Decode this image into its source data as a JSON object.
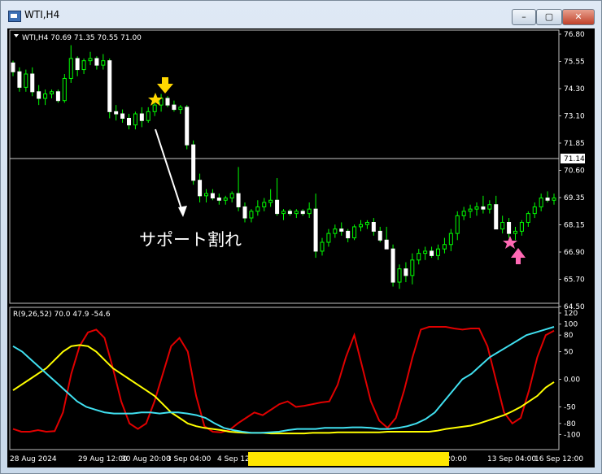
{
  "window": {
    "title": "WTI,H4",
    "min_label": "–",
    "max_label": "▢",
    "close_label": "✕"
  },
  "price_panel": {
    "header": "WTI,H4  70.69 71.35 70.55 71.00",
    "price_labels": [
      "76.80",
      "75.55",
      "74.30",
      "73.10",
      "71.85",
      "70.60",
      "69.35",
      "68.15",
      "66.90",
      "65.70",
      "64.50"
    ],
    "current_price": "71.14",
    "annotation": "サポート割れ"
  },
  "indicator_panel": {
    "header": "R(9,26,52) 70.0 47.9 -54.6",
    "level_labels": [
      "120",
      "100",
      "80",
      "50",
      "0.00",
      "-50",
      "-80",
      "-100"
    ]
  },
  "time_axis": [
    "28 Aug 2024",
    "29 Aug 12:00",
    "30 Aug 20:00",
    "3 Sep 04:00",
    "4 Sep 12",
    "20:00",
    "13 Sep 04:00",
    "16 Sep 12:00"
  ],
  "colors": {
    "background": "#000000",
    "bull_candle": "#00ff00",
    "bear_candle": "#ffffff",
    "line_red": "#e00000",
    "line_yellow": "#ffff00",
    "line_cyan": "#40e0f0",
    "marker_yellow": "#ffd700",
    "marker_pink": "#ff69b4",
    "scroll_thumb": "#ffe600"
  },
  "chart_data": [
    {
      "type": "candlestick",
      "symbol": "WTI",
      "timeframe": "H4",
      "ylim": [
        64.5,
        76.8
      ],
      "ohlc": [
        [
          75.5,
          75.6,
          74.9,
          75.1
        ],
        [
          75.1,
          75.3,
          74.2,
          74.4
        ],
        [
          74.4,
          75.2,
          74.2,
          75.0
        ],
        [
          75.0,
          75.3,
          74.0,
          74.2
        ],
        [
          74.2,
          74.5,
          73.6,
          73.9
        ],
        [
          73.9,
          74.3,
          73.6,
          74.1
        ],
        [
          74.1,
          74.3,
          73.9,
          74.2
        ],
        [
          74.2,
          74.3,
          73.7,
          73.8
        ],
        [
          73.8,
          75.0,
          73.7,
          74.8
        ],
        [
          74.8,
          76.3,
          74.6,
          75.7
        ],
        [
          75.7,
          75.8,
          74.9,
          75.2
        ],
        [
          75.2,
          75.7,
          75.0,
          75.6
        ],
        [
          75.6,
          76.0,
          75.4,
          75.7
        ],
        [
          75.7,
          75.8,
          75.2,
          75.4
        ],
        [
          75.4,
          75.9,
          75.2,
          75.6
        ],
        [
          75.6,
          75.7,
          73.0,
          73.3
        ],
        [
          73.3,
          73.6,
          72.9,
          73.2
        ],
        [
          73.2,
          73.4,
          72.8,
          73.0
        ],
        [
          73.0,
          73.2,
          72.5,
          72.7
        ],
        [
          72.7,
          73.3,
          72.5,
          73.2
        ],
        [
          73.2,
          73.5,
          72.6,
          72.9
        ],
        [
          72.9,
          73.5,
          72.8,
          73.3
        ],
        [
          73.3,
          73.8,
          73.1,
          73.6
        ],
        [
          73.6,
          74.1,
          73.3,
          73.9
        ],
        [
          73.9,
          74.0,
          73.5,
          73.6
        ],
        [
          73.6,
          73.8,
          73.3,
          73.4
        ],
        [
          73.4,
          73.6,
          73.2,
          73.5
        ],
        [
          73.5,
          73.6,
          71.6,
          71.8
        ],
        [
          71.8,
          72.0,
          70.0,
          70.2
        ],
        [
          70.2,
          70.5,
          69.2,
          69.5
        ],
        [
          69.5,
          69.8,
          69.2,
          69.6
        ],
        [
          69.6,
          69.8,
          69.3,
          69.4
        ],
        [
          69.4,
          69.6,
          69.1,
          69.3
        ],
        [
          69.3,
          69.5,
          69.1,
          69.4
        ],
        [
          69.4,
          69.7,
          69.2,
          69.6
        ],
        [
          69.6,
          70.8,
          68.8,
          69.0
        ],
        [
          69.0,
          69.2,
          68.3,
          68.5
        ],
        [
          68.5,
          68.9,
          68.3,
          68.8
        ],
        [
          68.8,
          69.3,
          68.6,
          69.0
        ],
        [
          69.0,
          69.4,
          68.8,
          69.2
        ],
        [
          69.2,
          69.8,
          69.0,
          69.3
        ],
        [
          69.3,
          70.3,
          68.6,
          68.7
        ],
        [
          68.7,
          68.9,
          68.4,
          68.8
        ],
        [
          68.8,
          68.9,
          68.6,
          68.7
        ],
        [
          68.7,
          68.9,
          68.5,
          68.8
        ],
        [
          68.8,
          68.9,
          68.6,
          68.7
        ],
        [
          68.7,
          69.2,
          68.5,
          68.9
        ],
        [
          68.9,
          69.6,
          66.7,
          67.0
        ],
        [
          67.0,
          67.6,
          66.8,
          67.4
        ],
        [
          67.4,
          68.0,
          67.2,
          67.8
        ],
        [
          67.8,
          68.2,
          67.6,
          68.0
        ],
        [
          68.0,
          68.3,
          67.7,
          67.9
        ],
        [
          67.9,
          68.0,
          67.4,
          67.6
        ],
        [
          67.6,
          68.2,
          67.5,
          68.1
        ],
        [
          68.1,
          68.4,
          67.9,
          68.2
        ],
        [
          68.2,
          68.4,
          68.0,
          68.3
        ],
        [
          68.3,
          68.5,
          67.7,
          67.9
        ],
        [
          67.9,
          68.1,
          67.4,
          67.5
        ],
        [
          67.5,
          68.1,
          67.2,
          67.1
        ],
        [
          67.1,
          67.3,
          65.4,
          65.6
        ],
        [
          65.6,
          66.4,
          65.3,
          66.2
        ],
        [
          66.2,
          66.5,
          65.6,
          65.9
        ],
        [
          65.9,
          66.9,
          65.5,
          66.6
        ],
        [
          66.6,
          67.1,
          66.4,
          66.9
        ],
        [
          66.9,
          67.2,
          66.6,
          67.0
        ],
        [
          67.0,
          67.2,
          66.7,
          66.8
        ],
        [
          66.8,
          67.3,
          66.6,
          67.1
        ],
        [
          67.1,
          67.6,
          66.9,
          67.3
        ],
        [
          67.3,
          68.0,
          67.0,
          67.8
        ],
        [
          67.8,
          68.8,
          67.5,
          68.6
        ],
        [
          68.6,
          69.0,
          68.4,
          68.8
        ],
        [
          68.8,
          69.1,
          68.5,
          68.9
        ],
        [
          68.9,
          69.2,
          68.6,
          69.0
        ],
        [
          69.0,
          69.5,
          68.7,
          68.9
        ],
        [
          68.9,
          69.3,
          68.7,
          69.1
        ],
        [
          69.1,
          69.5,
          68.9,
          68.0
        ],
        [
          68.0,
          68.6,
          67.8,
          68.3
        ],
        [
          68.3,
          68.5,
          67.6,
          67.8
        ],
        [
          67.8,
          68.1,
          67.5,
          67.9
        ],
        [
          67.9,
          68.4,
          67.7,
          68.3
        ],
        [
          68.3,
          68.8,
          68.1,
          68.7
        ],
        [
          68.7,
          69.2,
          68.5,
          69.0
        ],
        [
          69.0,
          69.6,
          68.8,
          69.4
        ],
        [
          69.4,
          69.7,
          69.2,
          69.3
        ],
        [
          69.3,
          69.6,
          69.1,
          69.4
        ]
      ],
      "annotations": [
        "yellow star + down arrow near 3 Sep",
        "white arrow with text サポート割れ",
        "pink star + up arrow near 13 Sep"
      ]
    },
    {
      "type": "line",
      "indicator": "R(9,26,52)",
      "ylim": [
        -120,
        120
      ],
      "series": [
        {
          "color": "#e00000",
          "values": [
            -90,
            -95,
            -95,
            -92,
            -95,
            -94,
            -60,
            10,
            60,
            85,
            90,
            75,
            20,
            -40,
            -80,
            -90,
            -80,
            -40,
            10,
            60,
            75,
            50,
            -30,
            -85,
            -95,
            -96,
            -92,
            -80,
            -70,
            -60,
            -65,
            -55,
            -45,
            -40,
            -50,
            -48,
            -45,
            -42,
            -40,
            -10,
            40,
            80,
            20,
            -40,
            -75,
            -88,
            -70,
            -20,
            40,
            90,
            95,
            95,
            95,
            92,
            90,
            92,
            92,
            60,
            0,
            -60,
            -80,
            -70,
            -20,
            40,
            80,
            88
          ]
        },
        {
          "color": "#ffff00",
          "values": [
            -20,
            -10,
            0,
            10,
            20,
            35,
            50,
            60,
            62,
            60,
            50,
            35,
            20,
            10,
            0,
            -10,
            -20,
            -30,
            -45,
            -60,
            -70,
            -80,
            -85,
            -88,
            -90,
            -92,
            -95,
            -96,
            -97,
            -97,
            -97,
            -98,
            -98,
            -98,
            -98,
            -98,
            -97,
            -97,
            -97,
            -96,
            -96,
            -96,
            -96,
            -96,
            -96,
            -95,
            -95,
            -95,
            -95,
            -95,
            -95,
            -93,
            -90,
            -88,
            -86,
            -84,
            -80,
            -75,
            -70,
            -65,
            -58,
            -50,
            -40,
            -30,
            -15,
            -5
          ]
        },
        {
          "color": "#40e0f0",
          "values": [
            60,
            50,
            35,
            20,
            5,
            -10,
            -25,
            -40,
            -50,
            -55,
            -60,
            -62,
            -62,
            -62,
            -60,
            -60,
            -62,
            -60,
            -60,
            -62,
            -65,
            -70,
            -80,
            -88,
            -92,
            -95,
            -97,
            -97,
            -96,
            -95,
            -92,
            -90,
            -90,
            -90,
            -88,
            -88,
            -88,
            -87,
            -87,
            -88,
            -90,
            -90,
            -88,
            -85,
            -80,
            -72,
            -60,
            -40,
            -20,
            0,
            10,
            25,
            40,
            50,
            60,
            70,
            80,
            85,
            90,
            95
          ]
        }
      ]
    }
  ]
}
